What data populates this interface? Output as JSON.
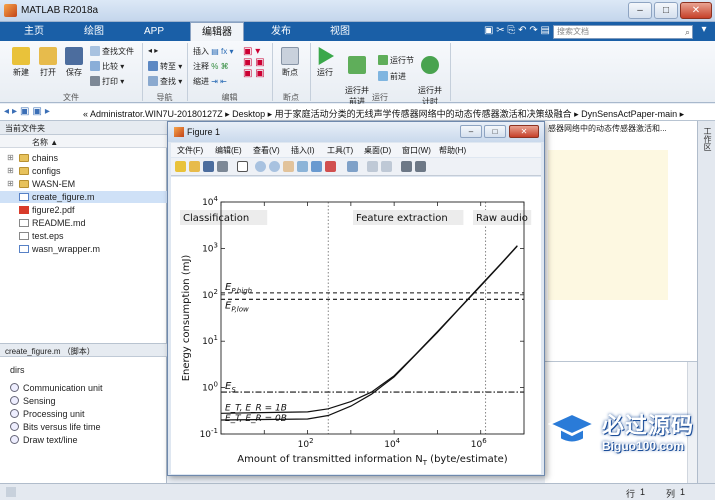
{
  "window": {
    "title": "MATLAB R2018a",
    "buttons": {
      "minimize": "–",
      "maximize": "□",
      "close": "✕"
    }
  },
  "tabs": [
    {
      "label": "主页"
    },
    {
      "label": "绘图"
    },
    {
      "label": "APP"
    },
    {
      "label": "编辑器"
    },
    {
      "label": "发布"
    },
    {
      "label": "视图"
    }
  ],
  "search": {
    "placeholder": "搜索文档"
  },
  "ribbon": {
    "file": {
      "new": "新建",
      "open": "打开",
      "save": "保存",
      "find_files": "查找文件",
      "compare": "比较",
      "print": "打印",
      "section": "文件"
    },
    "nav": {
      "goto": "转至",
      "find": "查找",
      "section": "导航"
    },
    "edit": {
      "insert": "插入",
      "comment": "注释",
      "indent": "缩进",
      "section": "编辑"
    },
    "breakpoints": {
      "breakpoint": "断点",
      "section": "断点"
    },
    "run": {
      "run": "运行",
      "run_advance": "运行并\n前进",
      "run_section": "运行节",
      "advance": "前进",
      "run_time": "运行并\n计时",
      "section": "运行"
    }
  },
  "address": {
    "path": "« Administrator.WIN7U-20180127Z ▸ Desktop ▸ 用于家庭活动分类的无线声学传感器网络中的动态传感器激活和决策级融合 ▸ DynSensActPaper-main ▸"
  },
  "current_folder": {
    "header": "当前文件夹",
    "name_col": "名称 ▲",
    "items": [
      {
        "name": "chains",
        "type": "folder"
      },
      {
        "name": "configs",
        "type": "folder"
      },
      {
        "name": "WASN-EM",
        "type": "folder"
      },
      {
        "name": "create_figure.m",
        "type": "m",
        "selected": true
      },
      {
        "name": "figure2.pdf",
        "type": "pdf"
      },
      {
        "name": "README.md",
        "type": "txt"
      },
      {
        "name": "test.eps",
        "type": "txt"
      },
      {
        "name": "wasn_wrapper.m",
        "type": "m"
      }
    ]
  },
  "details": {
    "header": "create_figure.m （脚本）",
    "title": "dirs",
    "items": [
      "Communication unit",
      "Sensing",
      "Processing unit",
      "Bits versus life time",
      "Draw text/line"
    ]
  },
  "editor": {
    "tab_label": "感器网络中的动态传感器激活和..."
  },
  "right_strip": {
    "label": "工作区"
  },
  "status": {
    "ln_label": "行",
    "ln": "1",
    "col_label": "列",
    "col": "1"
  },
  "figure": {
    "title": "Figure 1",
    "menu": [
      "文件(F)",
      "编辑(E)",
      "查看(V)",
      "插入(I)",
      "工具(T)",
      "桌面(D)",
      "窗口(W)",
      "帮助(H)"
    ]
  },
  "chart_data": {
    "type": "line",
    "xlabel": "Amount of transmitted information N_T (byte/estimate)",
    "ylabel": "Energy consumption (mJ)",
    "xscale": "log",
    "yscale": "log",
    "xlim": [
      1,
      10000000
    ],
    "ylim": [
      0.1,
      10000
    ],
    "yticks": [
      "10^{-1}",
      "10^{0}",
      "10^{1}",
      "10^{2}",
      "10^{3}",
      "10^{4}"
    ],
    "xticks": [
      "10^{2}",
      "10^{4}",
      "10^{6}"
    ],
    "regions": [
      {
        "label": "Classification",
        "x_end": 300
      },
      {
        "label": "Feature extraction",
        "x_end": 1300000
      },
      {
        "label": "Raw audio"
      }
    ],
    "hlines": [
      {
        "label": "E_{P,high}",
        "y": 110,
        "style": "dashed"
      },
      {
        "label": "E_{P,low}",
        "y": 80,
        "style": "dashed"
      },
      {
        "label": "E_S",
        "y": 0.8,
        "style": "dashdot"
      }
    ],
    "series": [
      {
        "label": "E_T, E_R = 1B",
        "x": [
          1,
          100,
          300,
          1000,
          3000,
          10000,
          30000,
          100000,
          300000,
          1000000,
          3000000,
          7000000
        ],
        "y": [
          0.28,
          0.3,
          0.35,
          0.5,
          0.8,
          1.8,
          5,
          16,
          48,
          160,
          480,
          1150
        ]
      },
      {
        "label": "E_T, E_R = 0B",
        "x": [
          1,
          100,
          300,
          1000,
          3000,
          10000,
          30000,
          100000,
          300000,
          1000000,
          3000000,
          7000000
        ],
        "y": [
          0.2,
          0.21,
          0.25,
          0.4,
          0.72,
          1.7,
          4.9,
          15.5,
          47,
          155,
          470,
          1120
        ]
      }
    ]
  }
}
